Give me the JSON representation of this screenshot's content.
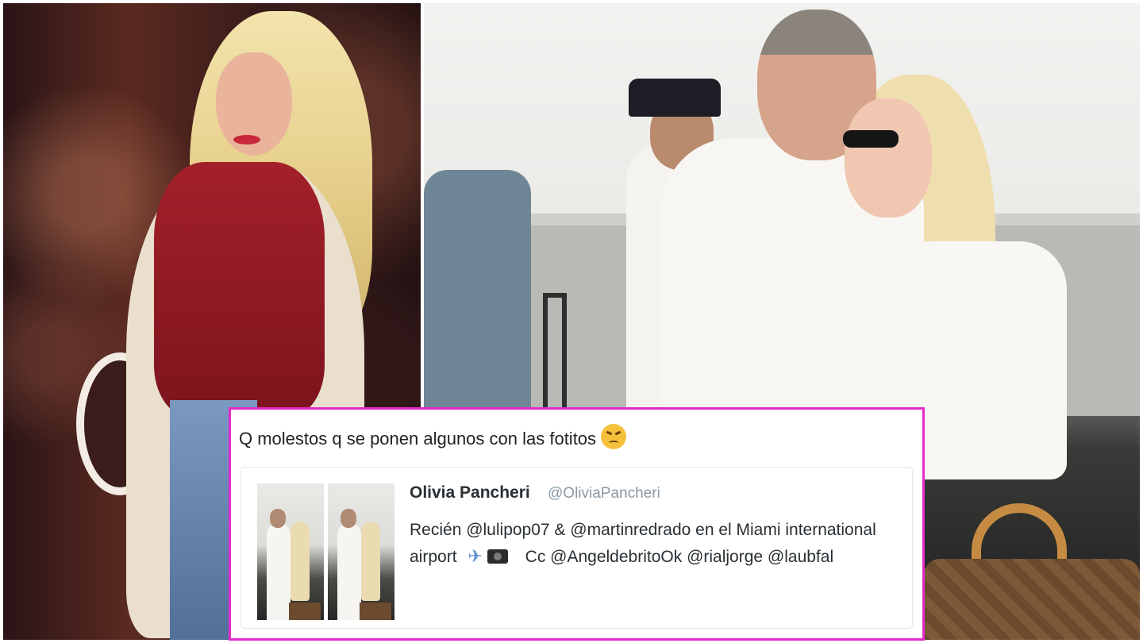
{
  "tweet": {
    "text": "Q molestos q se ponen algunos con las fotitos",
    "emoji": "angry-face-icon"
  },
  "quoted_tweet": {
    "display_name": "Olivia Pancheri",
    "handle": "@OliviaPancheri",
    "text_before_icons": "Recién @lulipop07 & @martinredrado en el Miami international airport",
    "text_after_icons": "Cc @AngeldebritoOk @rialjorge @laubfal",
    "icons": [
      "airplane-icon",
      "camera-icon"
    ],
    "thumbnail_count": 2
  },
  "colors": {
    "card_border": "#e42bc9",
    "handle_gray": "#8899a6",
    "text_dark": "#292f33"
  }
}
